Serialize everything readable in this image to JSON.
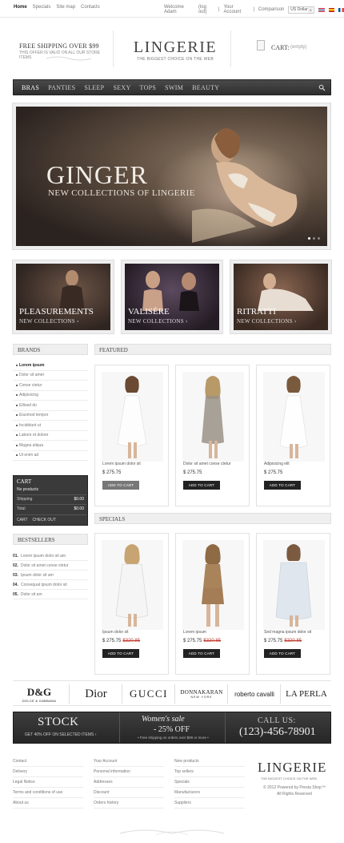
{
  "topbar": {
    "links": [
      "Home",
      "Specials",
      "Site map",
      "Contacts"
    ],
    "welcome": "Welcome Adam",
    "logout": "(log out)",
    "account": "Your Account",
    "compare": "Comparison",
    "currency": "US Dollar"
  },
  "header": {
    "shipping_title": "FREE SHIPPING OVER $99",
    "shipping_sub": "THIS OFFER IS VALID ON ALL OUR STORE ITEMS",
    "logo": "LINGERIE",
    "tagline": "THE BIGGEST CHOICE ON THE WEB",
    "cart_label": "CART:",
    "cart_status": "(empty)"
  },
  "nav": {
    "items": [
      "BRAS",
      "PANTIES",
      "SLEEP",
      "SEXY",
      "TOPS",
      "SWIM",
      "BEAUTY"
    ]
  },
  "banner": {
    "title": "GINGER",
    "subtitle": "NEW COLLECTIONS OF LINGERIE"
  },
  "promos": [
    {
      "title": "PLEASUREMENTS",
      "sub": "NEW COLLECTIONS ›"
    },
    {
      "title": "VALISÈRE",
      "sub": "NEW COLLECTIONS ›"
    },
    {
      "title": "RITRATTI",
      "sub": "NEW COLLECTIONS ›"
    }
  ],
  "sidebar": {
    "brands_title": "BRANDS",
    "brands": [
      "Lorem ipsum",
      "Dolor sit amet",
      "Conse ctetur",
      "Adipisicing",
      "Eiltsed do",
      "Eiusmod tempor",
      "Incididunt ut",
      "Labore et dolore",
      "Magna aliqua",
      "Ut enim ad"
    ],
    "cart_title": "CART",
    "cart_empty": "No products",
    "shipping_label": "Shipping",
    "shipping_value": "$0.00",
    "total_label": "Total",
    "total_value": "$0.00",
    "cart_btn": "CART",
    "checkout_btn": "CHECK OUT",
    "bestsellers_title": "BESTSELLERS",
    "bestsellers": [
      {
        "n": "01.",
        "t": "Lorem ipsum dolor sit am"
      },
      {
        "n": "02.",
        "t": "Dolor sit amet conse ctetur"
      },
      {
        "n": "03.",
        "t": "Ipsum dolor sit am"
      },
      {
        "n": "04.",
        "t": "Consequat ipsum dolor sit"
      },
      {
        "n": "05.",
        "t": "Dolor sit am"
      }
    ]
  },
  "featured": {
    "title": "FEATURED",
    "products": [
      {
        "name": "Lorem ipsum dolor sit",
        "price": "$ 275.75",
        "old": "",
        "btn": "ADD TO CART"
      },
      {
        "name": "Dolor sit amet conse ctetur",
        "price": "$ 275.75",
        "old": "",
        "btn": "ADD TO CART"
      },
      {
        "name": "Adipisicing elit",
        "price": "$ 275.75",
        "old": "",
        "btn": "ADD TO CART"
      }
    ]
  },
  "specials": {
    "title": "SPECIALS",
    "products": [
      {
        "name": "Ipsum dolor sit",
        "price": "$ 275.75",
        "old": "$320.85",
        "btn": "ADD TO CART"
      },
      {
        "name": "Lorem ipsum",
        "price": "$ 275.75",
        "old": "$320.85",
        "btn": "ADD TO CART"
      },
      {
        "name": "Sed magna ipsum dolor sit",
        "price": "$ 275.75",
        "old": "$320.85",
        "btn": "ADD TO CART"
      }
    ]
  },
  "brand_logos": [
    "D&G",
    "DOLCE & GABBANA",
    "Dior",
    "GUCCI",
    "DONNAKARAN",
    "NEW YORK",
    "roberto cavalli",
    "LA PERLA"
  ],
  "promo_strip": {
    "stock": "STOCK",
    "stock_sub": "GET 40% OFF ON SELECTED ITEMS ›",
    "sale": "Women's sale",
    "sale_pct": "- 25% OFF",
    "sale_sub": "• Free shipping on orders over $99 or more •",
    "call": "CALL US:",
    "phone": "(123)-456-78901"
  },
  "footer": {
    "col1": [
      "Contact",
      "Delivery",
      "Legal Notice",
      "Terms and conditions of use",
      "About us"
    ],
    "col2": [
      "Your Account",
      "Personal information",
      "Addresses",
      "Discount",
      "Orders history"
    ],
    "col3": [
      "New products",
      "Top sellers",
      "Specials",
      "Manufacturers",
      "Suppliers"
    ],
    "logo": "LINGERIE",
    "tagline": "THE BIGGEST CHOICE ON THE WEB",
    "copy1": "© 2012 Powered by Presta Shop™",
    "copy2": "All Rights Reserved"
  },
  "colors": {
    "dark": "#2e2e2e",
    "price_old": "#c0392b",
    "panel": "#efefef"
  }
}
